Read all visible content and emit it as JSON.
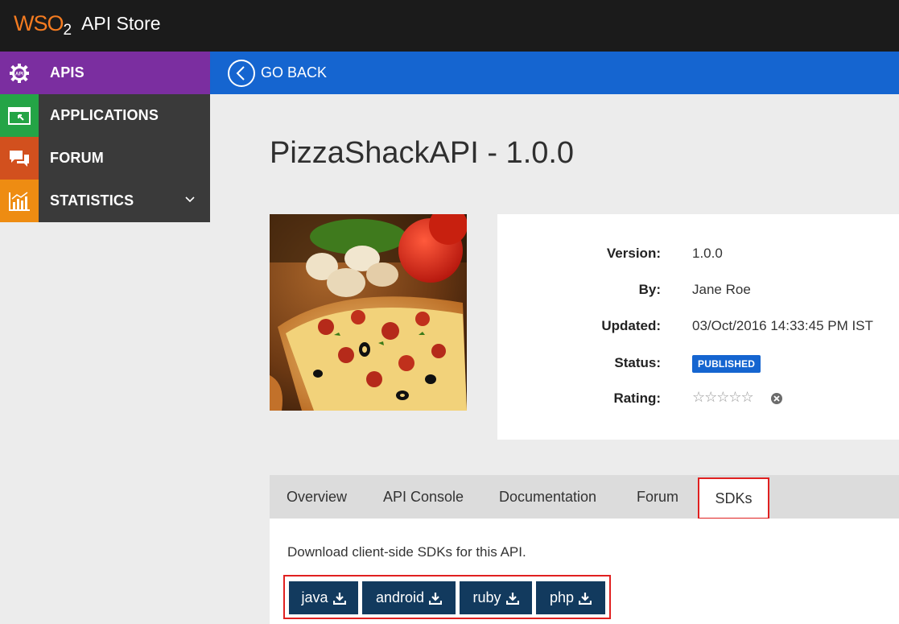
{
  "header": {
    "logo_text": "WSO",
    "logo_sub": "2",
    "app_name": "API Store"
  },
  "sidebar": {
    "items": [
      {
        "label": "APIS",
        "icon": "gear-api-icon"
      },
      {
        "label": "APPLICATIONS",
        "icon": "application-window-icon"
      },
      {
        "label": "FORUM",
        "icon": "chat-bubbles-icon"
      },
      {
        "label": "STATISTICS",
        "icon": "bar-chart-icon"
      }
    ]
  },
  "goback": {
    "label": "GO BACK"
  },
  "api": {
    "title": "PizzaShackAPI - 1.0.0",
    "fields": [
      {
        "key": "Version:",
        "value": "1.0.0"
      },
      {
        "key": "By:",
        "value": "Jane Roe"
      },
      {
        "key": "Updated:",
        "value": "03/Oct/2016 14:33:45 PM IST"
      },
      {
        "key": "Status:",
        "value": "PUBLISHED"
      },
      {
        "key": "Rating:",
        "value": "☆☆☆☆☆"
      }
    ],
    "rating_stars": 0
  },
  "tabs": [
    "Overview",
    "API Console",
    "Documentation",
    "Forum",
    "SDKs"
  ],
  "active_tab": "SDKs",
  "sdk": {
    "description": "Download client-side SDKs for this API.",
    "buttons": [
      "java",
      "android",
      "ruby",
      "php"
    ]
  },
  "colors": {
    "topbar": "#1b1b1b",
    "apis_purple": "#7b2ea0",
    "apps_green": "#24a446",
    "forum_orange": "#d2501e",
    "stats_orange": "#ee8c12",
    "goback_blue": "#1565d0",
    "sdk_button": "#123a5e",
    "highlight_red": "#e02020"
  }
}
